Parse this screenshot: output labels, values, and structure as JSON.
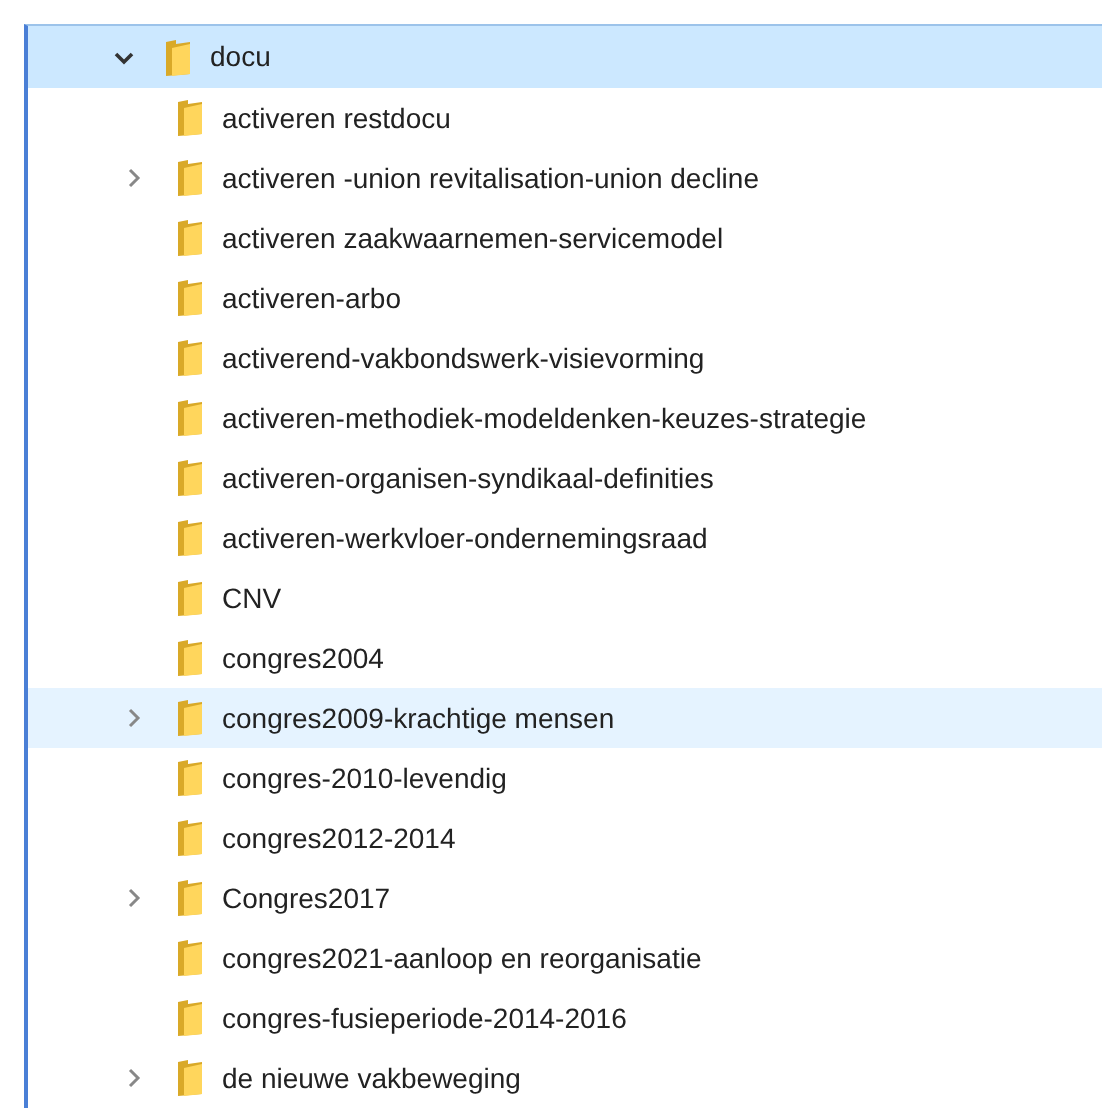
{
  "tree": {
    "label": "docu",
    "expanded": true,
    "selected": true,
    "children": [
      {
        "label": "activeren restdocu",
        "expandable": false,
        "highlighted": false
      },
      {
        "label": "activeren -union revitalisation-union decline",
        "expandable": true,
        "highlighted": false
      },
      {
        "label": "activeren zaakwaarnemen-servicemodel",
        "expandable": false,
        "highlighted": false
      },
      {
        "label": "activeren-arbo",
        "expandable": false,
        "highlighted": false
      },
      {
        "label": "activerend-vakbondswerk-visievorming",
        "expandable": false,
        "highlighted": false
      },
      {
        "label": "activeren-methodiek-modeldenken-keuzes-strategie",
        "expandable": false,
        "highlighted": false
      },
      {
        "label": "activeren-organisen-syndikaal-definities",
        "expandable": false,
        "highlighted": false
      },
      {
        "label": "activeren-werkvloer-ondernemingsraad",
        "expandable": false,
        "highlighted": false
      },
      {
        "label": "CNV",
        "expandable": false,
        "highlighted": false
      },
      {
        "label": "congres2004",
        "expandable": false,
        "highlighted": false
      },
      {
        "label": "congres2009-krachtige mensen",
        "expandable": true,
        "highlighted": true
      },
      {
        "label": "congres-2010-levendig",
        "expandable": false,
        "highlighted": false
      },
      {
        "label": "congres2012-2014",
        "expandable": false,
        "highlighted": false
      },
      {
        "label": "Congres2017",
        "expandable": true,
        "highlighted": false
      },
      {
        "label": "congres2021-aanloop en reorganisatie",
        "expandable": false,
        "highlighted": false
      },
      {
        "label": "congres-fusieperiode-2014-2016",
        "expandable": false,
        "highlighted": false
      },
      {
        "label": "de nieuwe vakbeweging",
        "expandable": true,
        "highlighted": false
      }
    ]
  }
}
